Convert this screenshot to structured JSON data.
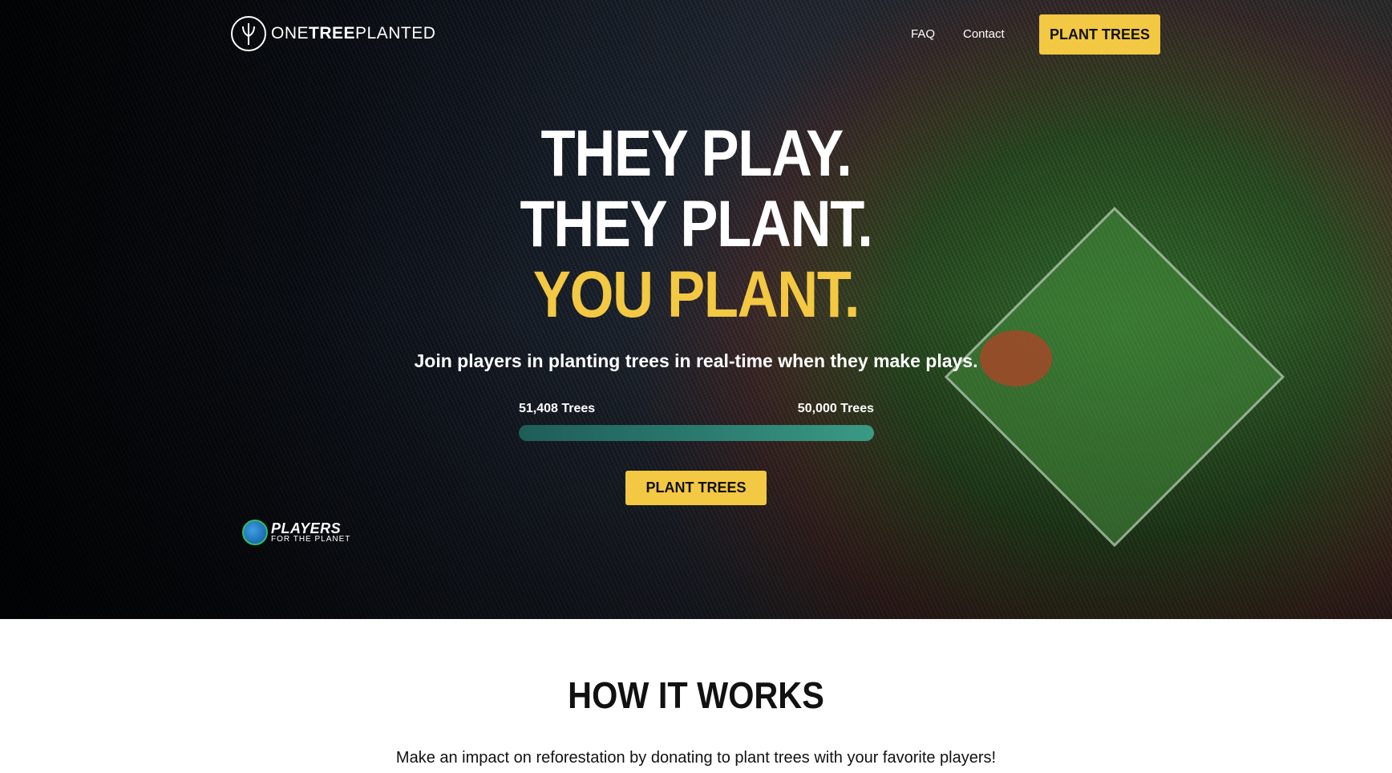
{
  "brand": {
    "logo_text_light_1": "ONE",
    "logo_text_bold": "TREE",
    "logo_text_light_2": "PLANTED",
    "logo_icon": "tree-icon"
  },
  "nav": {
    "faq": "FAQ",
    "contact": "Contact",
    "cta": "PLANT TREES"
  },
  "hero": {
    "line1": "THEY PLAY.",
    "line2": "THEY PLANT.",
    "line3": "YOU PLANT.",
    "subtitle": "Join players in planting trees in real-time when they make plays.",
    "progress": {
      "current_label": "51,408 Trees",
      "goal_label": "50,000 Trees",
      "fill_fraction": 1.0
    },
    "cta": "PLANT TREES",
    "partner": {
      "line1": "PLAYERS",
      "line2": "FOR THE PLANET",
      "icon": "globe-icon"
    }
  },
  "how_it_works": {
    "title": "HOW IT WORKS",
    "text": "Make an impact on reforestation by donating to plant trees with your favorite players!"
  },
  "colors": {
    "accent_yellow": "#f3c843",
    "progress_teal": "#2a7a6e"
  }
}
